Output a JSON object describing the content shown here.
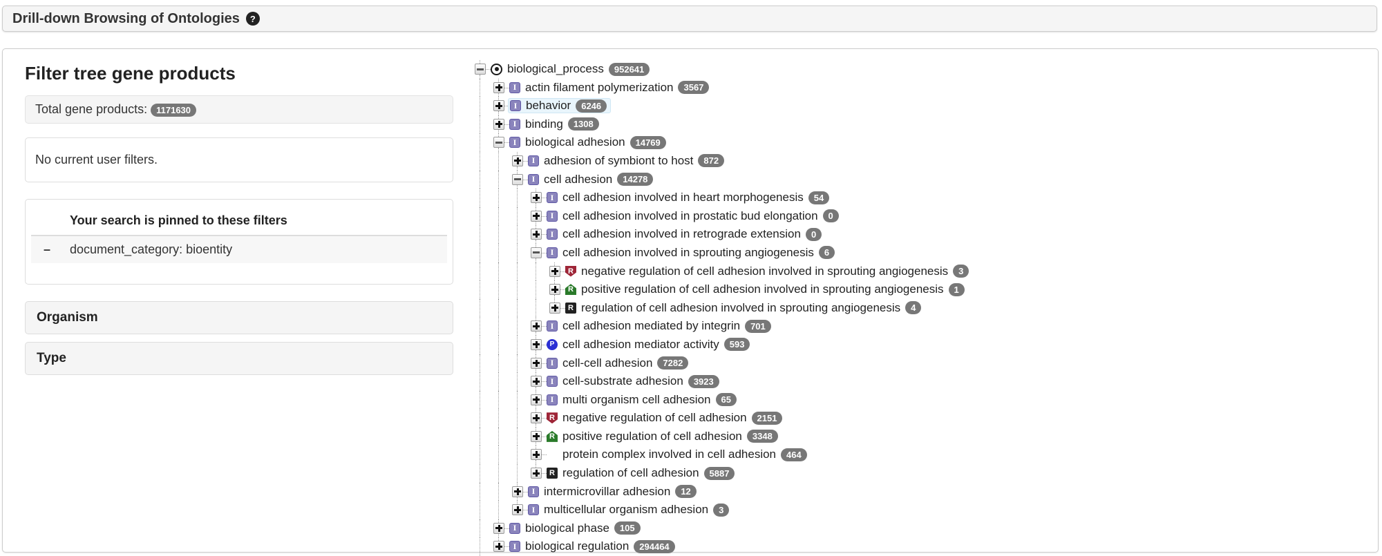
{
  "header": {
    "title": "Drill-down Browsing of Ontologies",
    "help_icon": "?"
  },
  "filter_panel": {
    "heading": "Filter tree gene products",
    "total_label": "Total gene products:",
    "total_count": "1171630",
    "no_filters_message": "No current user filters.",
    "pinned_heading": "Your search is pinned to these filters",
    "pinned_filters": [
      {
        "remove_label": "–",
        "filter": "document_category: bioentity"
      }
    ],
    "accordion_sections": [
      {
        "label": "Organism"
      },
      {
        "label": "Type"
      }
    ]
  },
  "colors": {
    "badge": "#777777",
    "is_a_icon": "#8a84bc",
    "part_of_icon": "#2b2fd4",
    "regulates_icon": "#222222",
    "negatively_regulates_icon": "#9e2537",
    "positively_regulates_icon": "#2a7a2a",
    "row_highlight": "#e9f5fc",
    "panel_header_bg": "#f5f5f5"
  },
  "tree": {
    "nodes": [
      {
        "label": "biological_process",
        "count": "952641",
        "icon": "root",
        "expander": "minus",
        "depth": 0
      },
      {
        "label": "actin filament polymerization",
        "count": "3567",
        "icon": "is_a",
        "expander": "plus",
        "depth": 1
      },
      {
        "label": "behavior",
        "count": "6246",
        "icon": "is_a",
        "expander": "plus",
        "depth": 1,
        "highlighted": true
      },
      {
        "label": "binding",
        "count": "1308",
        "icon": "is_a",
        "expander": "plus",
        "depth": 1
      },
      {
        "label": "biological adhesion",
        "count": "14769",
        "icon": "is_a",
        "expander": "minus",
        "depth": 1
      },
      {
        "label": "adhesion of symbiont to host",
        "count": "872",
        "icon": "is_a",
        "expander": "plus",
        "depth": 2
      },
      {
        "label": "cell adhesion",
        "count": "14278",
        "icon": "is_a",
        "expander": "minus",
        "depth": 2
      },
      {
        "label": "cell adhesion involved in heart morphogenesis",
        "count": "54",
        "icon": "is_a",
        "expander": "plus",
        "depth": 3
      },
      {
        "label": "cell adhesion involved in prostatic bud elongation",
        "count": "0",
        "icon": "is_a",
        "expander": "plus",
        "depth": 3
      },
      {
        "label": "cell adhesion involved in retrograde extension",
        "count": "0",
        "icon": "is_a",
        "expander": "plus",
        "depth": 3
      },
      {
        "label": "cell adhesion involved in sprouting angiogenesis",
        "count": "6",
        "icon": "is_a",
        "expander": "minus",
        "depth": 3
      },
      {
        "label": "negative regulation of cell adhesion involved in sprouting angiogenesis",
        "count": "3",
        "icon": "negatively_regulates",
        "expander": "plus",
        "depth": 4
      },
      {
        "label": "positive regulation of cell adhesion involved in sprouting angiogenesis",
        "count": "1",
        "icon": "positively_regulates",
        "expander": "plus",
        "depth": 4
      },
      {
        "label": "regulation of cell adhesion involved in sprouting angiogenesis",
        "count": "4",
        "icon": "regulates",
        "expander": "plus",
        "depth": 4
      },
      {
        "label": "cell adhesion mediated by integrin",
        "count": "701",
        "icon": "is_a",
        "expander": "plus",
        "depth": 3
      },
      {
        "label": "cell adhesion mediator activity",
        "count": "593",
        "icon": "part_of",
        "expander": "plus",
        "depth": 3
      },
      {
        "label": "cell-cell adhesion",
        "count": "7282",
        "icon": "is_a",
        "expander": "plus",
        "depth": 3
      },
      {
        "label": "cell-substrate adhesion",
        "count": "3923",
        "icon": "is_a",
        "expander": "plus",
        "depth": 3
      },
      {
        "label": "multi organism cell adhesion",
        "count": "65",
        "icon": "is_a",
        "expander": "plus",
        "depth": 3
      },
      {
        "label": "negative regulation of cell adhesion",
        "count": "2151",
        "icon": "negatively_regulates",
        "expander": "plus",
        "depth": 3
      },
      {
        "label": "positive regulation of cell adhesion",
        "count": "3348",
        "icon": "positively_regulates",
        "expander": "plus",
        "depth": 3
      },
      {
        "label": "protein complex involved in cell adhesion",
        "count": "464",
        "icon": "none",
        "expander": "plus",
        "depth": 3
      },
      {
        "label": "regulation of cell adhesion",
        "count": "5887",
        "icon": "regulates",
        "expander": "plus",
        "depth": 3
      },
      {
        "label": "intermicrovillar adhesion",
        "count": "12",
        "icon": "is_a",
        "expander": "plus",
        "depth": 2
      },
      {
        "label": "multicellular organism adhesion",
        "count": "3",
        "icon": "is_a",
        "expander": "plus",
        "depth": 2
      },
      {
        "label": "biological phase",
        "count": "105",
        "icon": "is_a",
        "expander": "plus",
        "depth": 1
      },
      {
        "label": "biological regulation",
        "count": "294464",
        "icon": "is_a",
        "expander": "plus",
        "depth": 1
      }
    ]
  }
}
